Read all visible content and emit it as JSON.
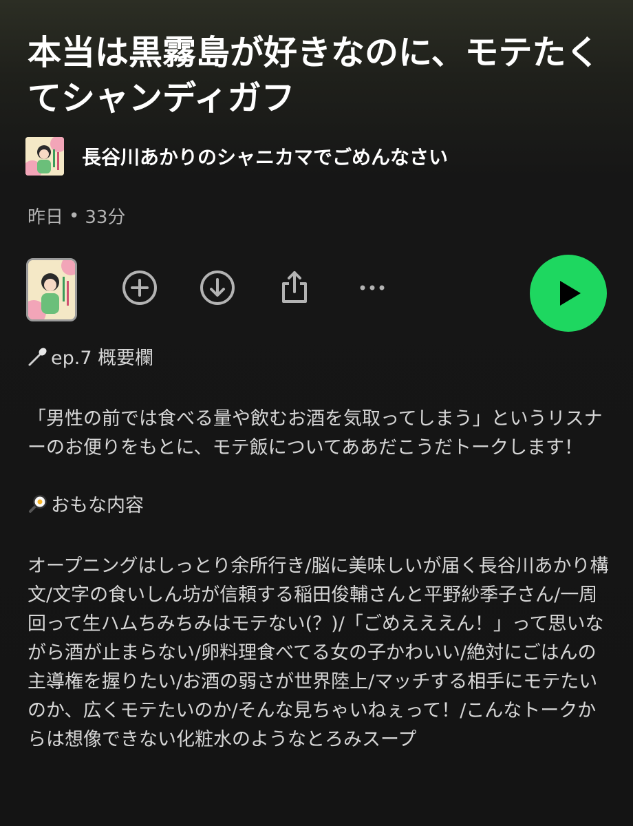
{
  "episode": {
    "title": "本当は黒霧島が好きなのに、モテたくてシャンディガフ",
    "show_name": "長谷川あかりのシャニカマでごめんなさい",
    "date": "昨日",
    "separator": "•",
    "duration": "33分"
  },
  "actions": {
    "add_icon": "plus-circle-icon",
    "download_icon": "download-circle-icon",
    "share_icon": "share-icon",
    "more_icon": "more-dots-icon",
    "play_icon": "play-icon"
  },
  "colors": {
    "accent": "#1ed760",
    "text_primary": "#ffffff",
    "text_secondary": "#b3b3b3",
    "description": "#d6d6d6"
  },
  "description": {
    "heading1": "ep.7 概要欄",
    "intro": "「男性の前では食べる量や飲むお酒を気取ってしまう」というリスナーのお便りをもとに、モテ飯についてああだこうだトークします！",
    "heading2": "おもな内容",
    "contents": "オープニングはしっとり余所行き/脳に美味しいが届く長谷川あかり構文/文字の食いしん坊が信頼する稲田俊輔さんと平野紗季子さん/一周回って生ハムちみちみはモテない(？)/「ごめえええん！」って思いながら酒が止まらない/卵料理食べてる女の子かわいい/絶対にごはんの主導権を握りたい/お酒の弱さが世界陸上/マッチする相手にモテたいのか、広くモテたいのか/そんな見ちゃいねぇって！/こんなトークからは想像できない化粧水のようなとろみスープ"
  }
}
